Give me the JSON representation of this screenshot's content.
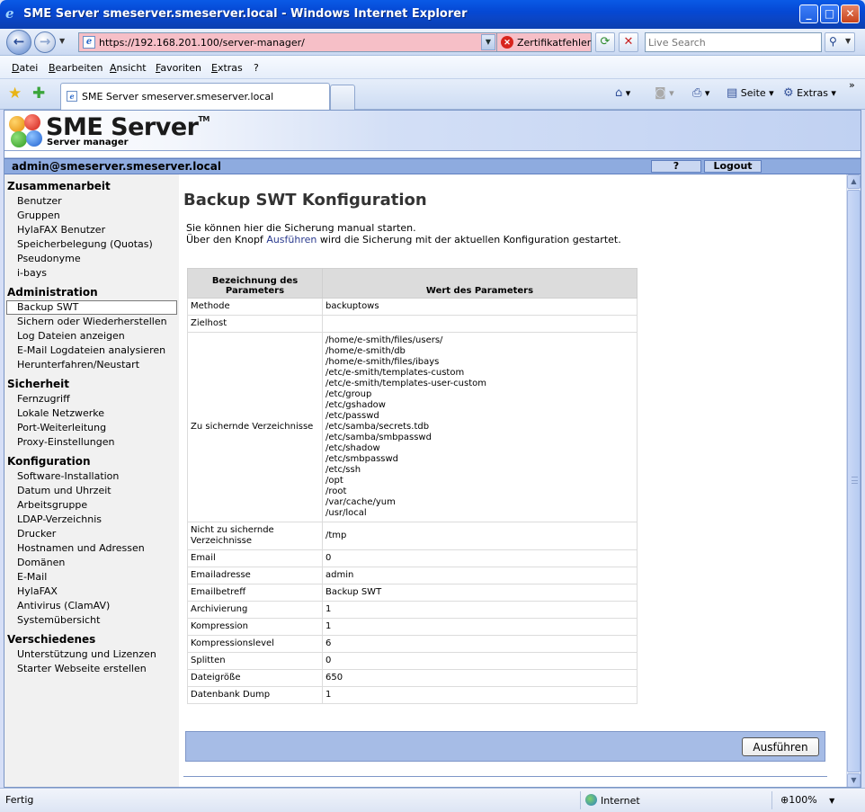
{
  "window": {
    "title": "SME Server smeserver.smeserver.local - Windows Internet Explorer"
  },
  "address": {
    "url": "https://192.168.201.100/server-manager/",
    "cert_error": "Zertifikatfehler",
    "search_placeholder": "Live Search"
  },
  "menu": [
    "Datei",
    "Bearbeiten",
    "Ansicht",
    "Favoriten",
    "Extras",
    "?"
  ],
  "tab": {
    "title": "SME Server smeserver.smeserver.local"
  },
  "toolbar": {
    "page": "Seite",
    "extras": "Extras"
  },
  "header": {
    "title": "SME Server",
    "tm": "TM",
    "subtitle": "Server manager",
    "user": "admin@smeserver.smeserver.local",
    "help": "?",
    "logout": "Logout"
  },
  "sidebar": [
    {
      "heading": "Zusammenarbeit",
      "items": [
        "Benutzer",
        "Gruppen",
        "HylaFAX Benutzer",
        "Speicherbelegung (Quotas)",
        "Pseudonyme",
        "i-bays"
      ]
    },
    {
      "heading": "Administration",
      "items": [
        "Backup SWT",
        "Sichern oder Wiederherstellen",
        "Log Dateien anzeigen",
        "E-Mail Logdateien analysieren",
        "Herunterfahren/Neustart"
      ]
    },
    {
      "heading": "Sicherheit",
      "items": [
        "Fernzugriff",
        "Lokale Netzwerke",
        "Port-Weiterleitung",
        "Proxy-Einstellungen"
      ]
    },
    {
      "heading": "Konfiguration",
      "items": [
        "Software-Installation",
        "Datum und Uhrzeit",
        "Arbeitsgruppe",
        "LDAP-Verzeichnis",
        "Drucker",
        "Hostnamen und Adressen",
        "Domänen",
        "E-Mail",
        "HylaFAX",
        "Antivirus (ClamAV)",
        "Systemübersicht"
      ]
    },
    {
      "heading": "Verschiedenes",
      "items": [
        "Unterstützung und Lizenzen",
        "Starter Webseite erstellen"
      ]
    }
  ],
  "sidebar_active": "Backup SWT",
  "main": {
    "title": "Backup SWT Konfiguration",
    "intro1": "Sie können hier die Sicherung manual starten.",
    "intro2_pre": "Über den Knopf ",
    "intro2_link": "Ausführen",
    "intro2_post": " wird die Sicherung mit der aktuellen Konfiguration gestartet.",
    "col_param_line1": "Bezeichnung des",
    "col_param_line2": "Parameters",
    "col_value": "Wert des Parameters",
    "rows": [
      {
        "label": "Methode",
        "value": "backuptows"
      },
      {
        "label": "Zielhost",
        "value": ""
      },
      {
        "label": "Zu sichernde Verzeichnisse",
        "values": [
          "/home/e-smith/files/users/",
          "/home/e-smith/db",
          "/home/e-smith/files/ibays",
          "/etc/e-smith/templates-custom",
          "/etc/e-smith/templates-user-custom",
          "/etc/group",
          "/etc/gshadow",
          "/etc/passwd",
          "/etc/samba/secrets.tdb",
          "/etc/samba/smbpasswd",
          "/etc/shadow",
          "/etc/smbpasswd",
          "/etc/ssh",
          "/opt",
          "/root",
          "/var/cache/yum",
          "/usr/local"
        ]
      },
      {
        "label": "Nicht zu sichernde Verzeichnisse",
        "value": "/tmp"
      },
      {
        "label": "Email",
        "value": "0"
      },
      {
        "label": "Emailadresse",
        "value": "admin"
      },
      {
        "label": "Emailbetreff",
        "value": "Backup SWT"
      },
      {
        "label": "Archivierung",
        "value": "1"
      },
      {
        "label": "Kompression",
        "value": "1"
      },
      {
        "label": "Kompressionslevel",
        "value": "6"
      },
      {
        "label": "Splitten",
        "value": "0"
      },
      {
        "label": "Dateigröße",
        "value": "650"
      },
      {
        "label": "Datenbank Dump",
        "value": "1"
      }
    ],
    "run_button": "Ausführen"
  },
  "status": {
    "left": "Fertig",
    "zone": "Internet",
    "zoom": "100%"
  }
}
